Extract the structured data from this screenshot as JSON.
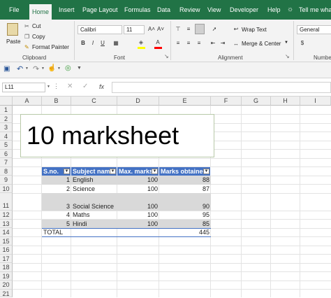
{
  "tabs": [
    "File",
    "Home",
    "Insert",
    "Page Layout",
    "Formulas",
    "Data",
    "Review",
    "View",
    "Developer",
    "Help",
    "Tell me what"
  ],
  "active_tab": "Home",
  "ribbon": {
    "paste_label": "Paste",
    "cut_label": "Cut",
    "copy_label": "Copy",
    "format_painter_label": "Format Painter",
    "clipboard_group": "Clipboard",
    "font_name": "Calibri",
    "font_size": "11",
    "bold": "B",
    "italic": "I",
    "underline": "U",
    "font_group": "Font",
    "wrap_text_label": "Wrap Text",
    "merge_center_label": "Merge & Center",
    "alignment_group": "Alignment",
    "number_format": "General",
    "number_group": "Numbe"
  },
  "formula_bar": {
    "name_box": "L11",
    "fx_label": "fx",
    "formula": ""
  },
  "columns": [
    "A",
    "B",
    "C",
    "D",
    "E",
    "F",
    "G",
    "H",
    "I"
  ],
  "rows": [
    "1",
    "2",
    "3",
    "4",
    "5",
    "6",
    "7",
    "8",
    "9",
    "10",
    "11",
    "12",
    "13",
    "14",
    "15",
    "16",
    "17",
    "18",
    "19",
    "20",
    "21"
  ],
  "title_box": "10 marksheet",
  "table": {
    "headers": [
      "S.no.",
      "Subject name",
      "Max. marks",
      "Marks obtained"
    ],
    "rows": [
      {
        "sno": "1",
        "subject": "English",
        "max": "100",
        "obtained": "88"
      },
      {
        "sno": "2",
        "subject": "Science",
        "max": "100",
        "obtained": "87"
      },
      {
        "sno": "3",
        "subject": "Social Science",
        "max": "100",
        "obtained": "90"
      },
      {
        "sno": "4",
        "subject": "Maths",
        "max": "100",
        "obtained": "95"
      },
      {
        "sno": "5",
        "subject": "Hindi",
        "max": "100",
        "obtained": "85"
      }
    ],
    "total_label": "TOTAL",
    "total_value": "445"
  },
  "colors": {
    "brand": "#217346",
    "table_header": "#4472c4",
    "band": "#d9d9d9"
  }
}
